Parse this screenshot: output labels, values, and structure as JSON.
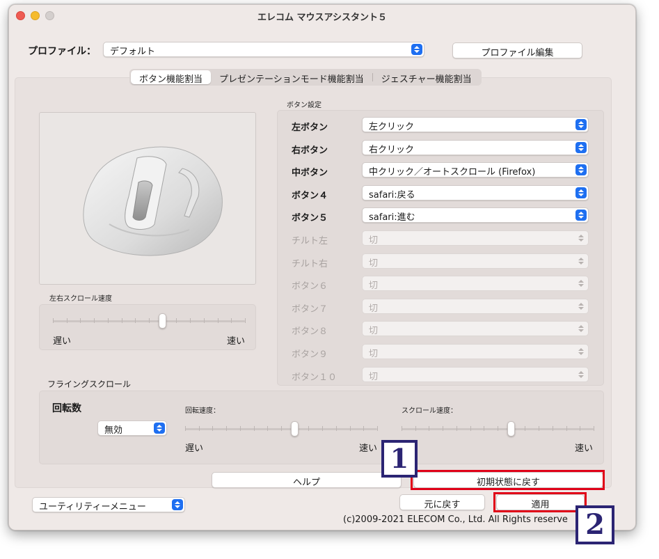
{
  "window": {
    "title": "エレコム マウスアシスタント５"
  },
  "profile": {
    "label": "プロファイル：",
    "selected": "デフォルト",
    "edit_button": "プロファイル編集"
  },
  "tabs": [
    {
      "label": "ボタン機能割当",
      "active": true
    },
    {
      "label": "プレゼンテーションモード機能割当",
      "active": false
    },
    {
      "label": "ジェスチャー機能割当",
      "active": false
    }
  ],
  "button_settings": {
    "title": "ボタン設定",
    "rows": [
      {
        "label": "左ボタン",
        "value": "左クリック",
        "enabled": true
      },
      {
        "label": "右ボタン",
        "value": "右クリック",
        "enabled": true
      },
      {
        "label": "中ボタン",
        "value": "中クリック／オートスクロール (Firefox)",
        "enabled": true
      },
      {
        "label": "ボタン４",
        "value": "safari:戻る",
        "enabled": true
      },
      {
        "label": "ボタン５",
        "value": "safari:進む",
        "enabled": true
      },
      {
        "label": "チルト左",
        "value": "切",
        "enabled": false
      },
      {
        "label": "チルト右",
        "value": "切",
        "enabled": false
      },
      {
        "label": "ボタン６",
        "value": "切",
        "enabled": false
      },
      {
        "label": "ボタン７",
        "value": "切",
        "enabled": false
      },
      {
        "label": "ボタン８",
        "value": "切",
        "enabled": false
      },
      {
        "label": "ボタン９",
        "value": "切",
        "enabled": false
      },
      {
        "label": "ボタン１０",
        "value": "切",
        "enabled": false
      }
    ]
  },
  "horizontal_scroll": {
    "title": "左右スクロール速度",
    "slow": "遅い",
    "fast": "速い",
    "level": 0.57
  },
  "flying_scroll": {
    "title": "フライングスクロール",
    "rotation_label": "回転数",
    "rotation_value": "無効",
    "rotation_speed": {
      "title": "回転速度：",
      "slow": "遅い",
      "fast": "速い",
      "level": 0.57
    },
    "scroll_speed": {
      "title": "スクロール速度：",
      "slow": "遅い",
      "fast": "速い",
      "level": 0.57
    }
  },
  "actions": {
    "help": "ヘルプ",
    "reset": "初期状態に戻す",
    "revert": "元に戻す",
    "apply": "適用"
  },
  "utility_menu": "ユーティリティーメニュー",
  "copyright": "(c)2009-2021 ELECOM Co., Ltd. All Rights reserve",
  "annotations": {
    "badge1": "1",
    "badge2": "2",
    "highlight_color": "#e00018",
    "badge_color": "#2b2473"
  }
}
